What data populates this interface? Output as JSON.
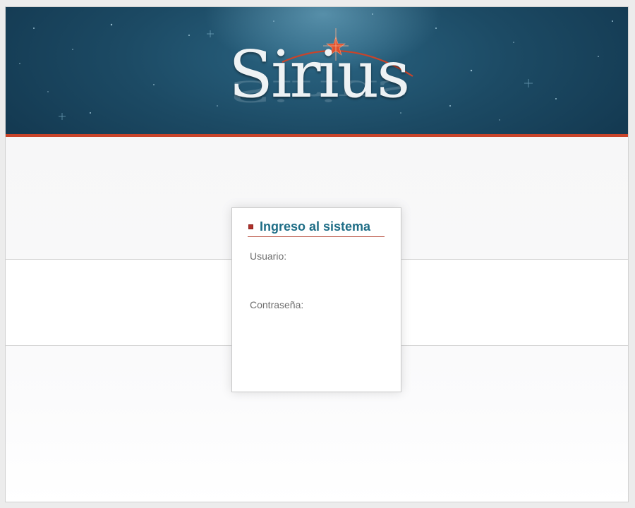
{
  "header": {
    "logo_text": "Sirius"
  },
  "login": {
    "title": "Ingreso al sistema",
    "username_label": "Usuario:",
    "username_value": "",
    "password_label": "Contraseña:",
    "password_value": ""
  },
  "colors": {
    "banner_dark": "#143a52",
    "banner_light": "#2a6482",
    "accent_red": "#c9442a",
    "title_teal": "#1e6d86",
    "label_gray": "#6f6f6f"
  }
}
